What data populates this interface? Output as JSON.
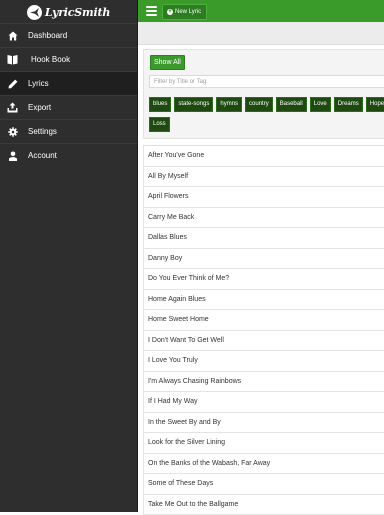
{
  "app": {
    "logo_text": "LyricSmith",
    "accent_color": "#3a9a2a",
    "tag_color": "#1e4a12"
  },
  "sidebar": {
    "items": [
      {
        "label": "Dashboard",
        "icon": "home-icon"
      },
      {
        "label": "Hook Book",
        "icon": "book-icon"
      },
      {
        "label": "Lyrics",
        "icon": "pencil-icon",
        "active": true
      },
      {
        "label": "Export",
        "icon": "export-icon"
      },
      {
        "label": "Settings",
        "icon": "gear-icon"
      },
      {
        "label": "Account",
        "icon": "user-icon"
      }
    ]
  },
  "toolbar": {
    "new_lyric_label": "New Lyric"
  },
  "filter": {
    "show_all_label": "Show All",
    "search_placeholder": "Filter by Title or Tag",
    "tags": [
      "blues",
      "state-songs",
      "hymns",
      "country",
      "Baseball",
      "Love",
      "Dreams",
      "Hope",
      "Loss"
    ]
  },
  "lyrics": [
    "After You've Gone",
    "All By Myself",
    "April Flowers",
    "Carry Me Back",
    "Dallas Blues",
    "Danny Boy",
    "Do You Ever Think of Me?",
    "Home Again Blues",
    "Home Sweet Home",
    "I Don't Want To Get Well",
    "I Love You Truly",
    "I'm Always Chasing Rainbows",
    "If I Had My Way",
    "In the Sweet By and By",
    "Look for the Silver Lining",
    "On the Banks of the Wabash, Far Away",
    "Some of These Days",
    "Take Me Out to the Ballgame"
  ]
}
